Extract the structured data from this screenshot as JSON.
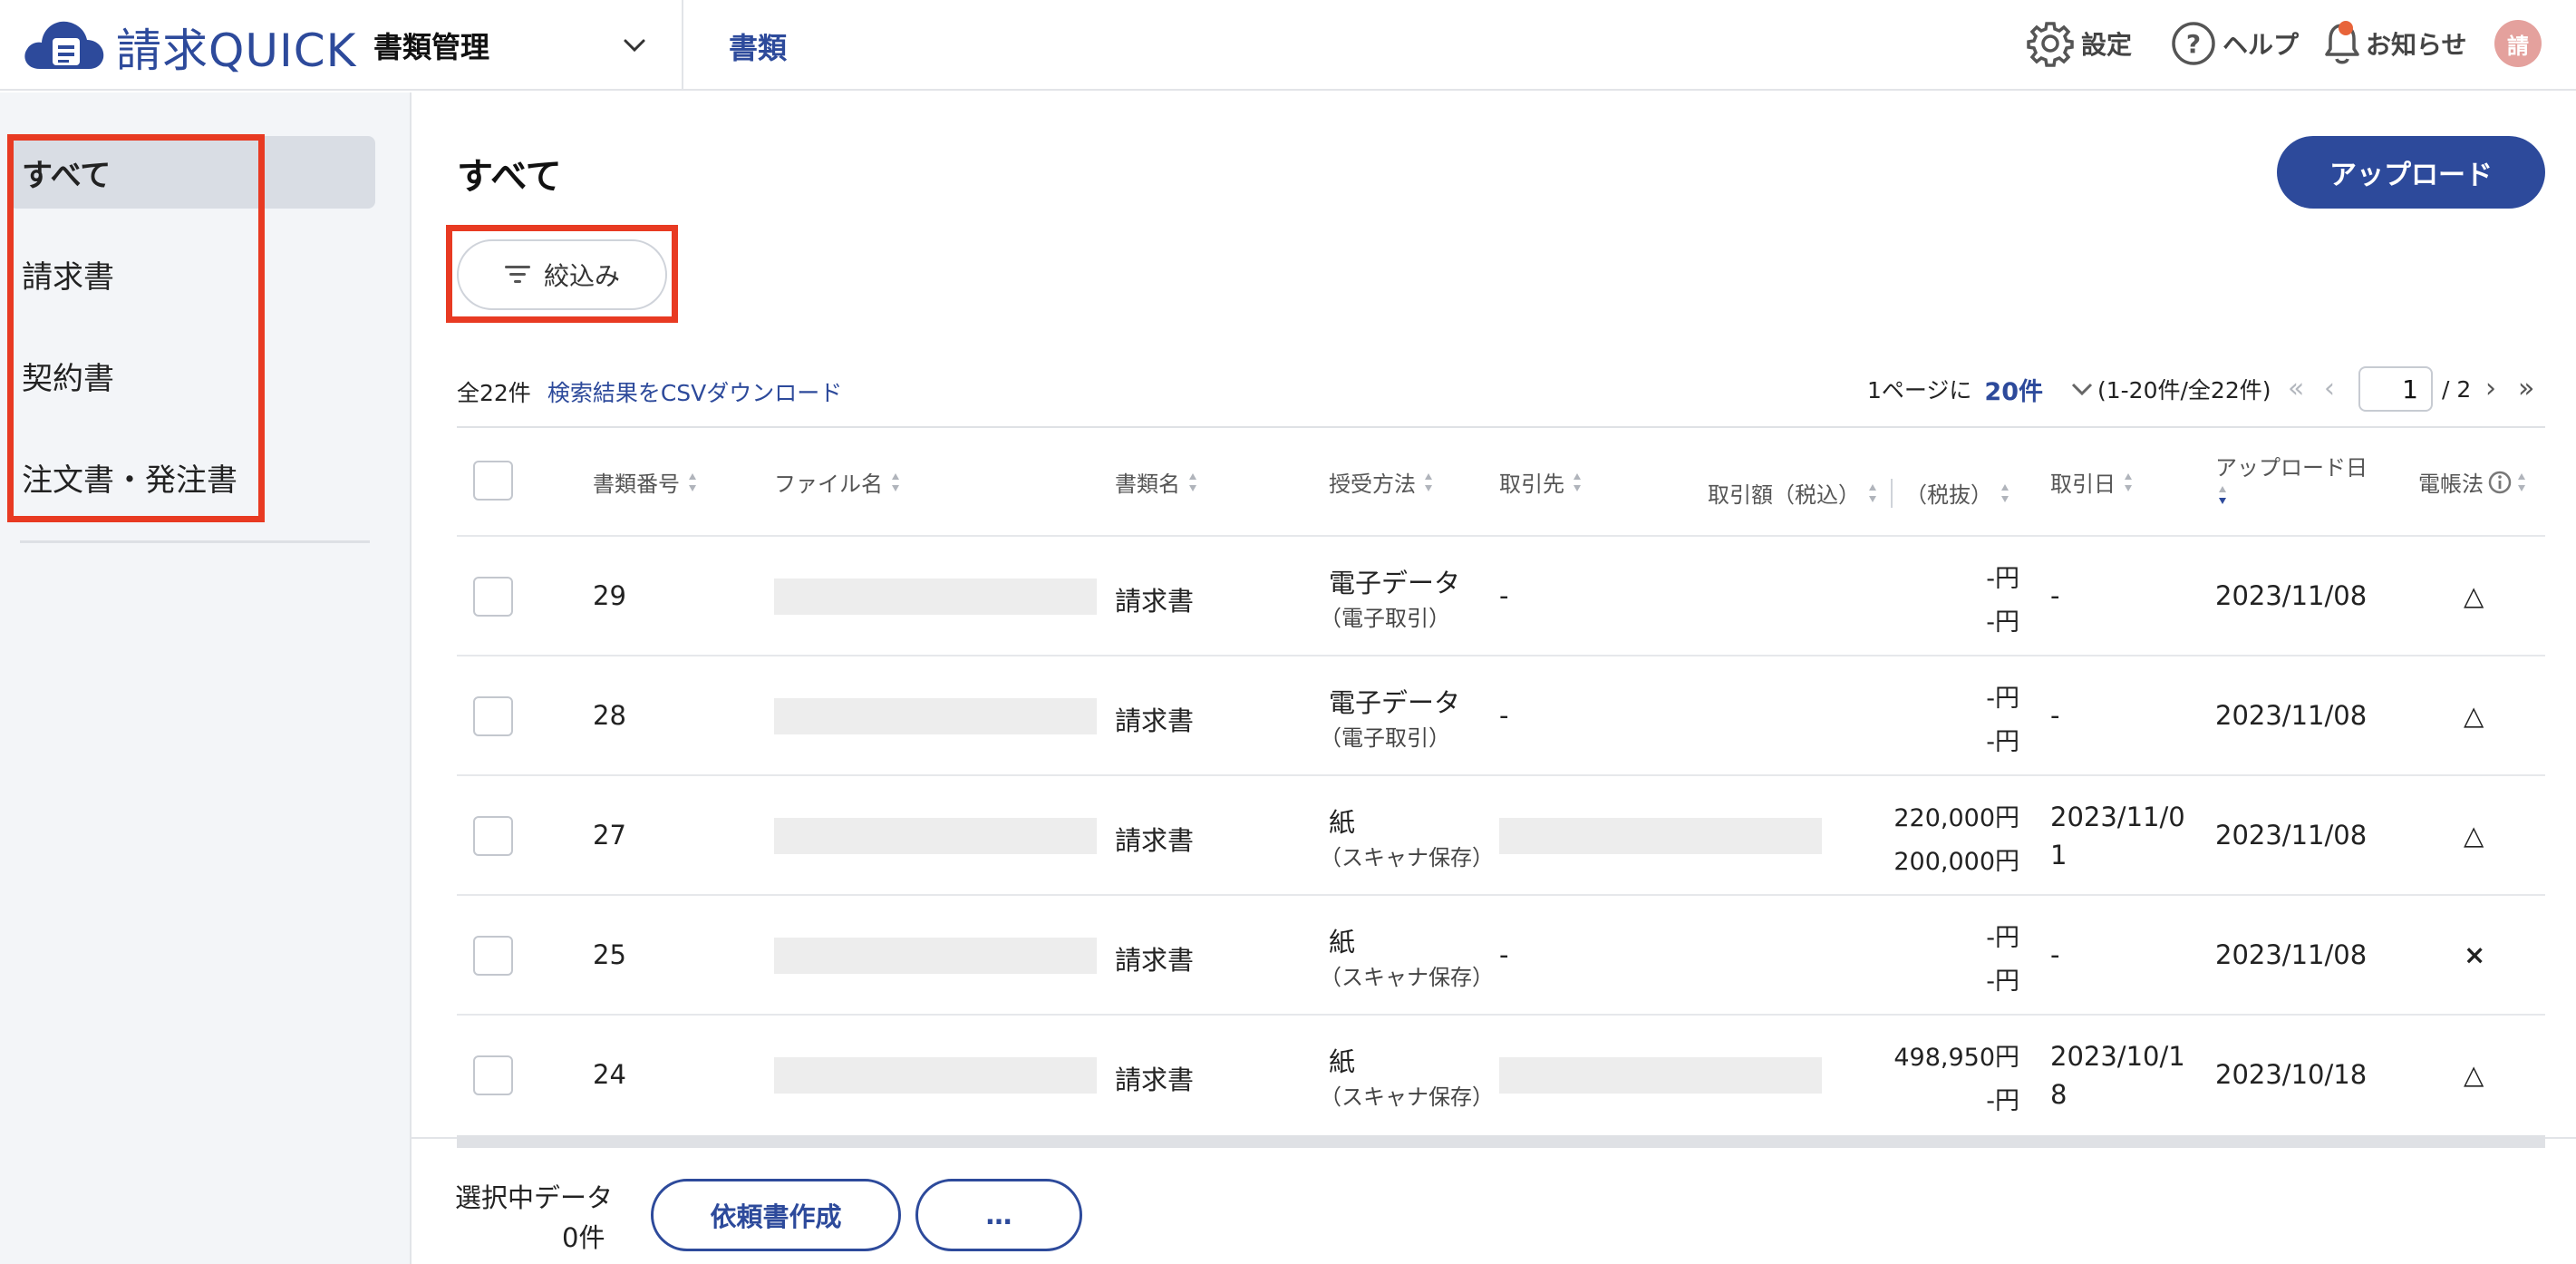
{
  "header": {
    "logo_text": "請求QUICK",
    "module": "書類管理",
    "nav_docs": "書類",
    "settings": "設定",
    "help": "ヘルプ",
    "notifications": "お知らせ",
    "avatar_initial": "請"
  },
  "sidebar": {
    "items": [
      {
        "label": "すべて",
        "active": true
      },
      {
        "label": "請求書"
      },
      {
        "label": "契約書"
      },
      {
        "label": "注文書・発注書"
      }
    ]
  },
  "main": {
    "title": "すべて",
    "upload_label": "アップロード",
    "filter_label": "絞込み",
    "total": "全22件",
    "csv_link": "検索結果をCSVダウンロード",
    "per_page_prefix": "1ページに",
    "per_page_value": "20件",
    "range": "(1-20件/全22件)",
    "current_page": "1",
    "total_pages": "/ 2"
  },
  "table": {
    "columns": {
      "doc_no": "書類番号",
      "file_name": "ファイル名",
      "doc_type": "書類名",
      "method": "授受方法",
      "partner": "取引先",
      "amount_incl": "取引額（税込）",
      "amount_excl": "（税抜）",
      "trade_date": "取引日",
      "upload_date": "アップロード日",
      "ledger_law": "電帳法"
    },
    "rows": [
      {
        "no": "29",
        "type": "請求書",
        "method": "電子データ",
        "method_sub": "（電子取引）",
        "partner": "-",
        "amount_incl": "-円",
        "amount_excl": "-円",
        "trade_date": "-",
        "trade_date_2": "",
        "upload": "2023/11/08",
        "law": "△"
      },
      {
        "no": "28",
        "type": "請求書",
        "method": "電子データ",
        "method_sub": "（電子取引）",
        "partner": "-",
        "amount_incl": "-円",
        "amount_excl": "-円",
        "trade_date": "-",
        "trade_date_2": "",
        "upload": "2023/11/08",
        "law": "△"
      },
      {
        "no": "27",
        "type": "請求書",
        "method": "紙",
        "method_sub": "（スキャナ保存）",
        "partner": "",
        "amount_incl": "220,000円",
        "amount_excl": "200,000円",
        "trade_date": "2023/11/0",
        "trade_date_2": "1",
        "upload": "2023/11/08",
        "law": "△"
      },
      {
        "no": "25",
        "type": "請求書",
        "method": "紙",
        "method_sub": "（スキャナ保存）",
        "partner": "-",
        "amount_incl": "-円",
        "amount_excl": "-円",
        "trade_date": "-",
        "trade_date_2": "",
        "upload": "2023/11/08",
        "law": "×"
      },
      {
        "no": "24",
        "type": "請求書",
        "method": "紙",
        "method_sub": "（スキャナ保存）",
        "partner": "",
        "amount_incl": "498,950円",
        "amount_excl": "-円",
        "trade_date": "2023/10/1",
        "trade_date_2": "8",
        "upload": "2023/10/18",
        "law": "△"
      }
    ]
  },
  "footer": {
    "selected_label": "選択中データ",
    "selected_count": "0件",
    "create_request": "依頼書作成",
    "more": "…"
  },
  "colors": {
    "brand": "#2d4a9b",
    "highlight": "#e83a22"
  }
}
